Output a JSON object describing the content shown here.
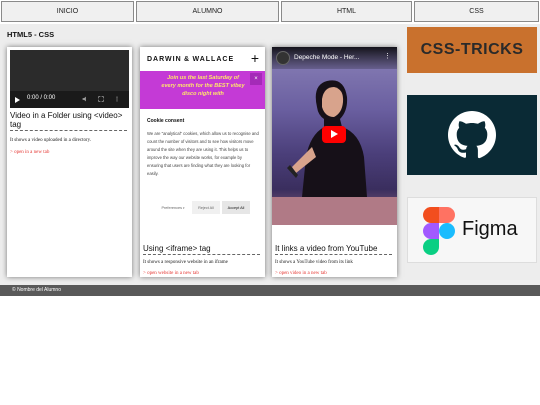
{
  "nav": {
    "inicio": "INICIO",
    "alumno": "ALUMNO",
    "html": "HTML",
    "css": "CSS"
  },
  "page_title": "HTML5 - CSS",
  "cards": [
    {
      "title": "Video in a Folder using <video> tag",
      "description": "It shows a video uploaded in a directory.",
      "link": "> open in a new tab",
      "video_time": "0:00 / 0:00"
    },
    {
      "title": "Using <iframe> tag",
      "description": "It shows a responsive website in an iframe",
      "link": "> open website in a new tab",
      "site": {
        "logo": "DARWIN & WALLACE",
        "promo": "Join us the last Saturday of every month for the BEST vibey disco night with",
        "cookie_title": "Cookie consent",
        "cookie_text": "We are \"analytical\" cookies, which allow us to recognise and count the number of visitors and to see how visitors move around the site when they are using it. This helps us to improve the way our website works, for example by ensuring that users are finding what they are looking for easily.",
        "btn_preferences": "Preferences",
        "btn_reject": "Reject All",
        "btn_accept": "Accept All"
      }
    },
    {
      "title": "It links a video from YouTube",
      "description": "It shows a YouTube video from its link",
      "link": "> open video in a new tab",
      "yt_title": "Depeche Mode - Her..."
    }
  ],
  "logos": {
    "css_tricks": "CSS-TRICKS",
    "github_icon": "github-icon",
    "figma": "Figma"
  },
  "footer": "© Nombre del Alumno",
  "colors": {
    "css_tricks_bg": "#c9712d",
    "github_bg": "#0a2a35",
    "link_red": "#e53935",
    "promo_bg": "#c43ad6",
    "footer_bg": "#595959"
  }
}
